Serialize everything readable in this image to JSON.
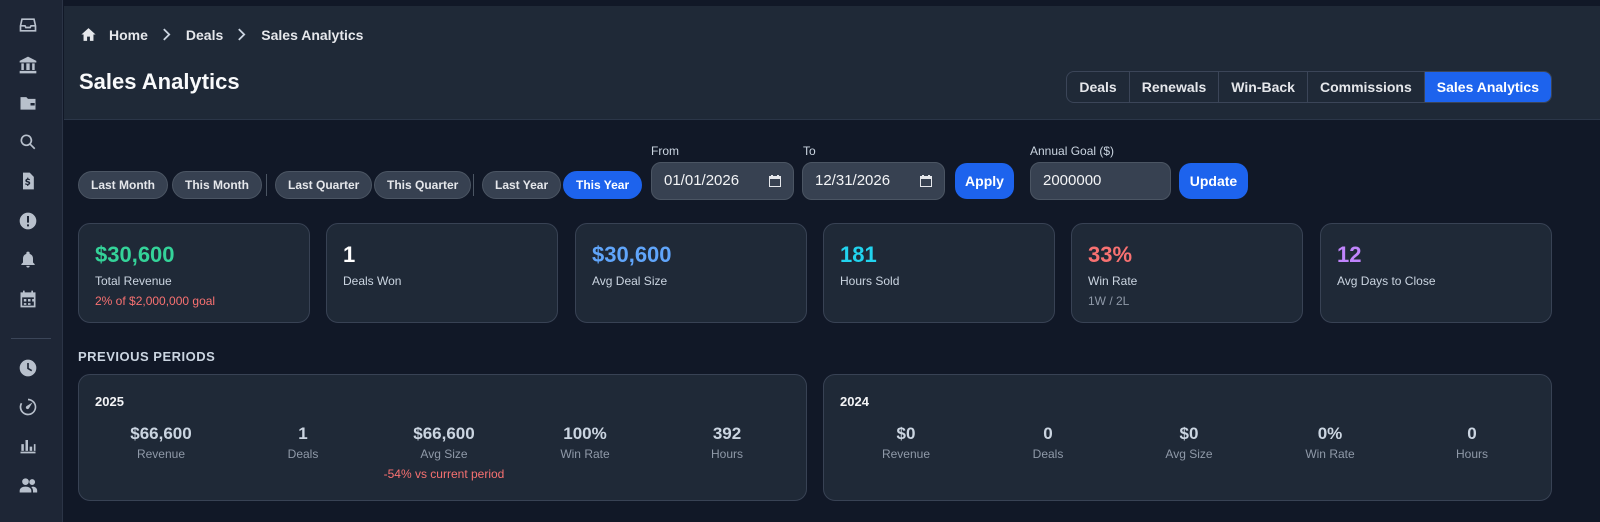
{
  "sidebar": {
    "icons": [
      "inbox-icon",
      "bank-icon",
      "wallet-icon",
      "search-icon",
      "document-dollar-icon",
      "alert-icon",
      "bell-icon",
      "calendar-icon",
      "clock-icon",
      "speedometer-icon",
      "chart-icon",
      "users-icon"
    ]
  },
  "breadcrumb": {
    "home": "Home",
    "deals": "Deals",
    "current": "Sales Analytics"
  },
  "page_title": "Sales Analytics",
  "tabs": [
    {
      "label": "Deals"
    },
    {
      "label": "Renewals"
    },
    {
      "label": "Win-Back"
    },
    {
      "label": "Commissions"
    },
    {
      "label": "Sales Analytics",
      "active": true
    }
  ],
  "filters": {
    "presets": [
      "Last Month",
      "This Month",
      "Last Quarter",
      "This Quarter",
      "Last Year",
      "This Year"
    ],
    "active_preset": "This Year",
    "from_label": "From",
    "from_value": "01/01/2026",
    "to_label": "To",
    "to_value": "12/31/2026",
    "apply_label": "Apply",
    "goal_label": "Annual Goal ($)",
    "goal_value": "2000000",
    "update_label": "Update"
  },
  "kpis": [
    {
      "value": "$30,600",
      "label": "Total Revenue",
      "sub": "2% of $2,000,000 goal",
      "color": "#34d399",
      "sub_color": "#f87171"
    },
    {
      "value": "1",
      "label": "Deals Won",
      "sub": "",
      "color": "#ffffff"
    },
    {
      "value": "$30,600",
      "label": "Avg Deal Size",
      "sub": "",
      "color": "#60a5fa"
    },
    {
      "value": "181",
      "label": "Hours Sold",
      "sub": "",
      "color": "#22d3ee"
    },
    {
      "value": "33%",
      "label": "Win Rate",
      "sub": "1W / 2L",
      "color": "#f87171",
      "sub_color": "#8f99a8"
    },
    {
      "value": "12",
      "label": "Avg Days to Close",
      "sub": "",
      "color": "#c084fc"
    }
  ],
  "previous_periods": {
    "title": "PREVIOUS PERIODS",
    "periods": [
      {
        "year": "2025",
        "stats": [
          {
            "value": "$66,600",
            "label": "Revenue"
          },
          {
            "value": "1",
            "label": "Deals"
          },
          {
            "value": "$66,600",
            "label": "Avg Size",
            "delta": "-54% vs current period"
          },
          {
            "value": "100%",
            "label": "Win Rate"
          },
          {
            "value": "392",
            "label": "Hours"
          }
        ]
      },
      {
        "year": "2024",
        "stats": [
          {
            "value": "$0",
            "label": "Revenue"
          },
          {
            "value": "0",
            "label": "Deals"
          },
          {
            "value": "$0",
            "label": "Avg Size"
          },
          {
            "value": "0%",
            "label": "Win Rate"
          },
          {
            "value": "0",
            "label": "Hours"
          }
        ]
      }
    ]
  }
}
